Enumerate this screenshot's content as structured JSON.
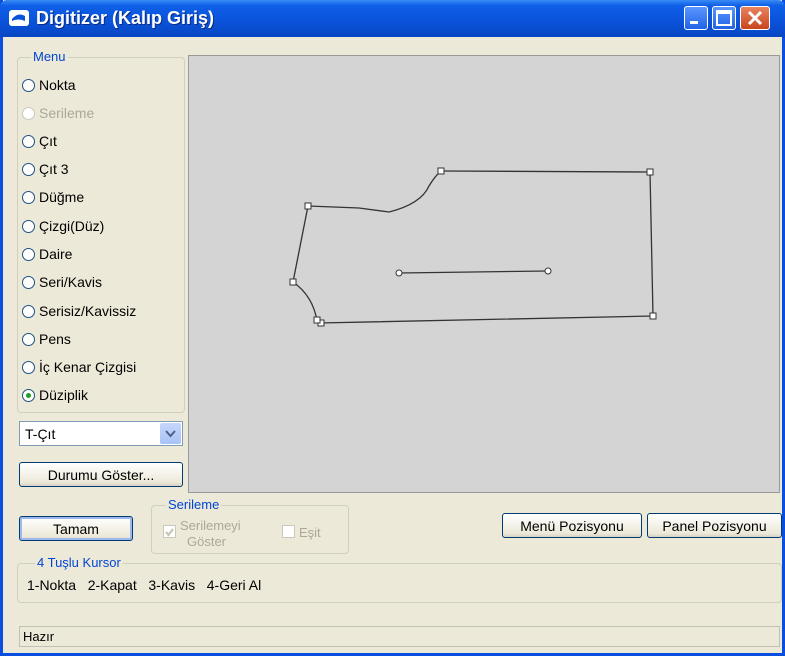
{
  "window": {
    "title": "Digitizer (Kalıp Giriş)"
  },
  "menu": {
    "label": "Menu",
    "items": [
      {
        "label": "Nokta",
        "checked": false,
        "disabled": false
      },
      {
        "label": "Serileme",
        "checked": false,
        "disabled": true
      },
      {
        "label": "Çıt",
        "checked": false,
        "disabled": false
      },
      {
        "label": "Çıt 3",
        "checked": false,
        "disabled": false
      },
      {
        "label": "Düğme",
        "checked": false,
        "disabled": false
      },
      {
        "label": "Çizgi(Düz)",
        "checked": false,
        "disabled": false
      },
      {
        "label": "Daire",
        "checked": false,
        "disabled": false
      },
      {
        "label": "Seri/Kavis",
        "checked": false,
        "disabled": false
      },
      {
        "label": "Serisiz/Kavissiz",
        "checked": false,
        "disabled": false
      },
      {
        "label": "Pens",
        "checked": false,
        "disabled": false
      },
      {
        "label": "İç Kenar Çizgisi",
        "checked": false,
        "disabled": false
      },
      {
        "label": "Düziplik",
        "checked": true,
        "disabled": false
      }
    ]
  },
  "type_select": {
    "value": "T-Çıt"
  },
  "buttons": {
    "durumu": "Durumu Göster...",
    "tamam": "Tamam",
    "menu_pozisyonu": "Menü Pozisyonu",
    "panel_pozisyonu": "Panel Pozisyonu"
  },
  "serileme_group": {
    "label": "Serileme",
    "show_label_1": "Serilemeyi",
    "show_label_2": "Göster",
    "esit_label": "Eşit"
  },
  "cursor_group": {
    "label": "4 Tuşlu Kursor",
    "keys": "1-Nokta   2-Kapat   3-Kavis   4-Geri Al"
  },
  "status": {
    "text": "Hazır"
  },
  "colors": {
    "titlebar": "#0a52d9",
    "group_label": "#0046d5",
    "canvas": "#d4d4d4"
  }
}
